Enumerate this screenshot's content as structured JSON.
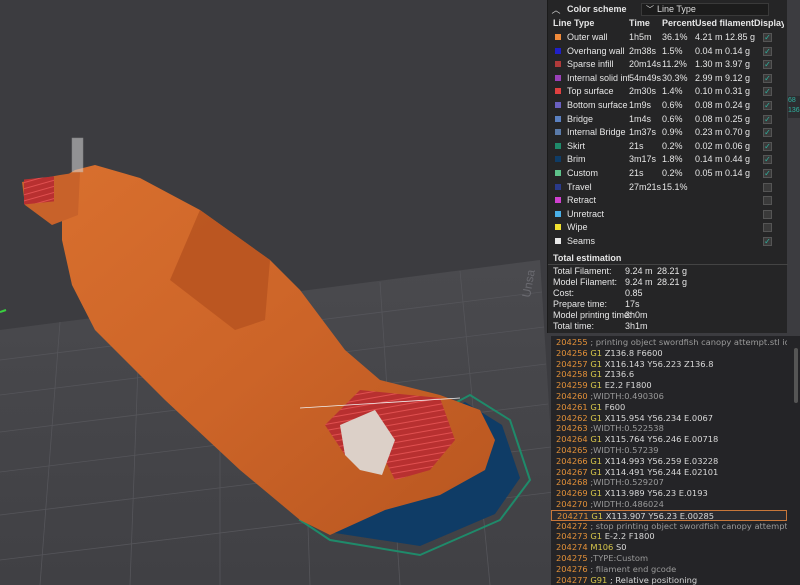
{
  "colors": {
    "bg": "#3c3c40",
    "panel": "#252526",
    "accent": "#2fb2a0",
    "model_orange": "#d4692a",
    "brim_blue": "#0f3c66",
    "highlight_orange": "#e39038"
  },
  "legend": {
    "collapse_icon": "chevron-up-icon",
    "title": "Color scheme",
    "scheme_value": "Line Type",
    "columns": {
      "type": "Line Type",
      "time": "Time",
      "percent": "Percent",
      "filament": "Used filament",
      "display": "Display"
    },
    "rows": [
      {
        "name": "Outer wall",
        "time": "1h5m",
        "percent": "36.1%",
        "filament": "4.21 m 12.85 g",
        "color": "#f08a3a",
        "display": true
      },
      {
        "name": "Overhang wall",
        "time": "2m38s",
        "percent": "1.5%",
        "filament": "0.04 m 0.14 g",
        "color": "#2020c8",
        "display": true
      },
      {
        "name": "Sparse infill",
        "time": "20m14s",
        "percent": "11.2%",
        "filament": "1.30 m 3.97 g",
        "color": "#b03a3a",
        "display": true
      },
      {
        "name": "Internal solid infill",
        "time": "54m49s",
        "percent": "30.3%",
        "filament": "2.99 m 9.12 g",
        "color": "#9a40b8",
        "display": true
      },
      {
        "name": "Top surface",
        "time": "2m30s",
        "percent": "1.4%",
        "filament": "0.10 m 0.31 g",
        "color": "#e04040",
        "display": true
      },
      {
        "name": "Bottom surface",
        "time": "1m9s",
        "percent": "0.6%",
        "filament": "0.08 m 0.24 g",
        "color": "#6a60c0",
        "display": true
      },
      {
        "name": "Bridge",
        "time": "1m4s",
        "percent": "0.6%",
        "filament": "0.08 m 0.25 g",
        "color": "#5a80c0",
        "display": true
      },
      {
        "name": "Internal Bridge",
        "time": "1m37s",
        "percent": "0.9%",
        "filament": "0.23 m 0.70 g",
        "color": "#5a7aa8",
        "display": true
      },
      {
        "name": "Skirt",
        "time": "21s",
        "percent": "0.2%",
        "filament": "0.02 m 0.06 g",
        "color": "#1f8a6a",
        "display": true
      },
      {
        "name": "Brim",
        "time": "3m17s",
        "percent": "1.8%",
        "filament": "0.14 m 0.44 g",
        "color": "#0f3c66",
        "display": true
      },
      {
        "name": "Custom",
        "time": "21s",
        "percent": "0.2%",
        "filament": "0.05 m 0.14 g",
        "color": "#5ec28a",
        "display": true
      },
      {
        "name": "Travel",
        "time": "27m21s",
        "percent": "15.1%",
        "filament": "",
        "color": "#2a3a8a",
        "display": false
      },
      {
        "name": "Retract",
        "time": "",
        "percent": "",
        "filament": "",
        "color": "#d040d0",
        "display": false
      },
      {
        "name": "Unretract",
        "time": "",
        "percent": "",
        "filament": "",
        "color": "#4ab0e8",
        "display": false
      },
      {
        "name": "Wipe",
        "time": "",
        "percent": "",
        "filament": "",
        "color": "#f0e030",
        "display": false
      },
      {
        "name": "Seams",
        "time": "",
        "percent": "",
        "filament": "",
        "color": "#e8e8e8",
        "display": true
      }
    ]
  },
  "estimation": {
    "title": "Total estimation",
    "rows": [
      {
        "label": "Total Filament:",
        "v1": "9.24 m",
        "v2": "28.21 g"
      },
      {
        "label": "Model Filament:",
        "v1": "9.24 m",
        "v2": "28.21 g"
      },
      {
        "label": "Cost:",
        "v1": "0.85",
        "v2": ""
      },
      {
        "label": "Prepare time:",
        "v1": "17s",
        "v2": ""
      },
      {
        "label": "Model printing time:",
        "v1": "3h0m",
        "v2": ""
      },
      {
        "label": "Total time:",
        "v1": "3h1m",
        "v2": ""
      }
    ]
  },
  "gcode": {
    "lines": [
      {
        "num": "204255",
        "cmd": "",
        "args": "",
        "comment": "; printing object swordfish canopy attempt.stl id:24..."
      },
      {
        "num": "204256",
        "cmd": "G1",
        "args": "Z136.8 F6600",
        "comment": ""
      },
      {
        "num": "204257",
        "cmd": "G1",
        "args": "X116.143 Y56.223 Z136.8",
        "comment": ""
      },
      {
        "num": "204258",
        "cmd": "G1",
        "args": "Z136.6",
        "comment": ""
      },
      {
        "num": "204259",
        "cmd": "G1",
        "args": "E2.2 F1800",
        "comment": ""
      },
      {
        "num": "204260",
        "cmd": "",
        "args": "",
        "comment": ";WIDTH:0.490306"
      },
      {
        "num": "204261",
        "cmd": "G1",
        "args": "F600",
        "comment": ""
      },
      {
        "num": "204262",
        "cmd": "G1",
        "args": "X115.954 Y56.234 E.0067",
        "comment": ""
      },
      {
        "num": "204263",
        "cmd": "",
        "args": "",
        "comment": ";WIDTH:0.522538"
      },
      {
        "num": "204264",
        "cmd": "G1",
        "args": "X115.764 Y56.246 E.00718",
        "comment": ""
      },
      {
        "num": "204265",
        "cmd": "",
        "args": "",
        "comment": ";WIDTH:0.57239"
      },
      {
        "num": "204266",
        "cmd": "G1",
        "args": "X114.993 Y56.259 E.03228",
        "comment": ""
      },
      {
        "num": "204267",
        "cmd": "G1",
        "args": "X114.491 Y56.244 E.02101",
        "comment": ""
      },
      {
        "num": "204268",
        "cmd": "",
        "args": "",
        "comment": ";WIDTH:0.529207"
      },
      {
        "num": "204269",
        "cmd": "G1",
        "args": "X113.989 Y56.23 E.0193",
        "comment": ""
      },
      {
        "num": "204270",
        "cmd": "",
        "args": "",
        "comment": ";WIDTH:0.486024"
      },
      {
        "num": "204271",
        "cmd": "G1",
        "args": "X113.907 Y56.23 E.00285",
        "comment": "",
        "active": true
      },
      {
        "num": "204272",
        "cmd": "",
        "args": "",
        "comment": "; stop printing object swordfish canopy attempt.stl id:..."
      },
      {
        "num": "204273",
        "cmd": "G1",
        "args": "E-2.2 F1800",
        "comment": ""
      },
      {
        "num": "204274",
        "cmd": "M106",
        "args": "S0",
        "comment": ""
      },
      {
        "num": "204275",
        "cmd": "",
        "args": "",
        "comment": ";TYPE:Custom"
      },
      {
        "num": "204276",
        "cmd": "",
        "args": "",
        "comment": "; filament end gcode"
      },
      {
        "num": "204277",
        "cmd": "G91",
        "args": "; Relative positioning",
        "comment": ""
      }
    ]
  },
  "bed_text": "Unsa",
  "side_tag": "68 136"
}
